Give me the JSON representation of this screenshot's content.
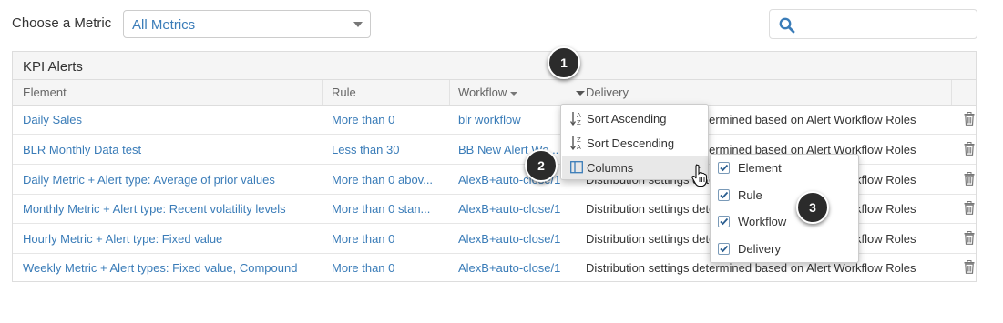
{
  "toolbar": {
    "metric_label": "Choose a Metric",
    "metric_value": "All Metrics",
    "search_value": "",
    "search_placeholder": ""
  },
  "panel": {
    "title": "KPI Alerts",
    "columns": [
      "Element",
      "Rule",
      "Workflow",
      "Delivery"
    ],
    "rows": [
      {
        "element": "Daily Sales",
        "rule": "More than 0",
        "workflow": "blr workflow",
        "delivery": "Distribution settings determined based on Alert Workflow Roles"
      },
      {
        "element": "BLR Monthly Data test",
        "rule": "Less than 30",
        "workflow": "BB New Alert Wo...",
        "delivery": "Distribution settings determined based on Alert Workflow Roles"
      },
      {
        "element": "Daily Metric + Alert type: Average of prior values",
        "rule": "More than 0 abov...",
        "workflow": "AlexB+auto-close/1",
        "delivery": "Distribution settings determined based on Alert Workflow Roles"
      },
      {
        "element": "Monthly Metric + Alert type: Recent volatility levels",
        "rule": "More than 0 stan...",
        "workflow": "AlexB+auto-close/1",
        "delivery": "Distribution settings determined based on Alert Workflow Roles"
      },
      {
        "element": "Hourly Metric + Alert type: Fixed value",
        "rule": "More than 0",
        "workflow": "AlexB+auto-close/1",
        "delivery": "Distribution settings determined based on Alert Workflow Roles"
      },
      {
        "element": "Weekly Metric + Alert types: Fixed value, Compound",
        "rule": "More than 0",
        "workflow": "AlexB+auto-close/1",
        "delivery": "Distribution settings determined based on Alert Workflow Roles"
      }
    ]
  },
  "column_menu": {
    "items": [
      "Sort Ascending",
      "Sort Descending",
      "Columns"
    ],
    "columns_submenu": [
      {
        "label": "Element",
        "checked": true
      },
      {
        "label": "Rule",
        "checked": true
      },
      {
        "label": "Workflow",
        "checked": true
      },
      {
        "label": "Delivery",
        "checked": true
      }
    ]
  },
  "callouts": [
    "1",
    "2",
    "3"
  ],
  "icons": {
    "search": "search-icon",
    "trash": "trash-icon",
    "sort_asc": "sort-ascending-icon",
    "sort_desc": "sort-descending-icon",
    "columns": "columns-icon",
    "checkbox": "checkbox-checked-icon",
    "cursor": "hand-pointer-icon"
  },
  "colors": {
    "link": "#3a7cb8",
    "header_bg": "#f5f5f5",
    "border": "#dddddd",
    "badge": "#2b2b2b",
    "menu_highlight": "#e8e8e8"
  }
}
